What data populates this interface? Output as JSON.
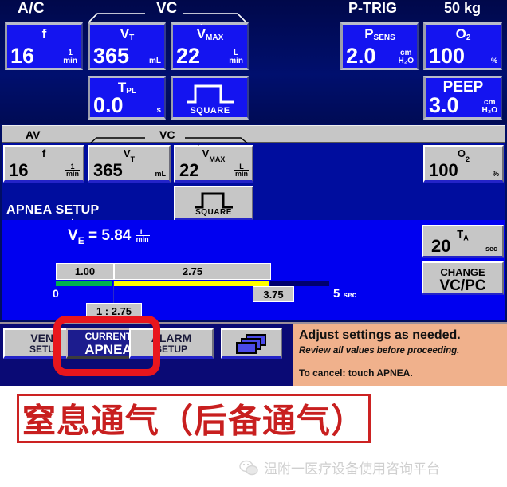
{
  "header": {
    "mode_label": "A/C",
    "vc_label": "VC",
    "trigger_label": "P-TRIG",
    "weight_label": "50 kg"
  },
  "main_keys": [
    {
      "label": "f",
      "sub": "",
      "value": "16",
      "unit_num": "1",
      "unit_den": "min",
      "dot": false
    },
    {
      "label": "V",
      "sub": "T",
      "value": "365",
      "unit": "mL",
      "dot": false
    },
    {
      "label": "V",
      "sub": "MAX",
      "value": "22",
      "unit_num": "L",
      "unit_den": "min",
      "dot": true
    },
    {
      "label": "T",
      "sub": "PL",
      "value": "0.0",
      "unit": "s",
      "dot": false
    }
  ],
  "waveform": {
    "label": "SQUARE",
    "icon": "square-wave-icon"
  },
  "right_keys": [
    {
      "label": "P",
      "sub": "SENS",
      "value": "2.0",
      "unit_top": "cm",
      "unit_bot": "H₂O"
    },
    {
      "label": "O",
      "sub": "2",
      "value": "100",
      "unit": "%"
    },
    {
      "label": "PEEP",
      "sub": "",
      "value": "3.0",
      "unit_top": "cm",
      "unit_bot": "H₂O"
    }
  ],
  "apnea": {
    "av_label": "AV",
    "vc_label": "VC",
    "panel_title": "APNEA SETUP",
    "keys": [
      {
        "label": "f",
        "sub": "",
        "value": "16",
        "unit_num": "1",
        "unit_den": "min",
        "dot": false
      },
      {
        "label": "V",
        "sub": "T",
        "value": "365",
        "unit": "mL",
        "dot": false
      },
      {
        "label": "V",
        "sub": "MAX",
        "value": "22",
        "unit_num": "L",
        "unit_den": "min",
        "dot": true
      }
    ],
    "o2": {
      "label": "O",
      "sub": "2",
      "value": "100",
      "unit": "%"
    },
    "waveform": {
      "label": "SQUARE",
      "icon": "square-wave-icon"
    },
    "minute_volume": {
      "symbol": "V",
      "sub": "E",
      "equals": "=",
      "value": "5.84",
      "unit_num": "L",
      "unit_den": "min"
    },
    "ta_button": {
      "label": "T",
      "sub": "A",
      "value": "20",
      "unit": "sec"
    },
    "change_button": {
      "line1": "CHANGE",
      "line2": "VC/PC"
    }
  },
  "timing_bar": {
    "inspiratory_time": "1.00",
    "expiratory_time": "2.75",
    "total_cycle": "3.75",
    "ie_ratio": "1 : 2.75",
    "tick_start": "0",
    "tick_end": "5",
    "tick_end_unit": "sec",
    "colors": {
      "inspiratory": "#00b050",
      "expiratory": "#ffff00",
      "remaining": "#00006e"
    }
  },
  "toolbar": {
    "buttons": [
      {
        "line1": "VENT",
        "line2": "SETUP",
        "selected": false
      },
      {
        "line1": "CURRENT",
        "line2": "APNEA",
        "selected": true
      },
      {
        "line1": "ALARM",
        "line2": "SETUP",
        "selected": false
      },
      {
        "line1": "",
        "line2": "",
        "icon": "windows-stack-icon",
        "selected": false
      }
    ],
    "message_primary": "Adjust settings as needed.",
    "message_secondary": "Review all values before proceeding.",
    "message_cancel": "To cancel: touch APNEA."
  },
  "annotation": {
    "highlight_color": "#e8161d",
    "caption": "窒息通气（后备通气）",
    "caption_color": "#c81f1f",
    "watermark": "温附一医疗设备使用咨询平台",
    "watermark_icon": "wechat-icon"
  }
}
